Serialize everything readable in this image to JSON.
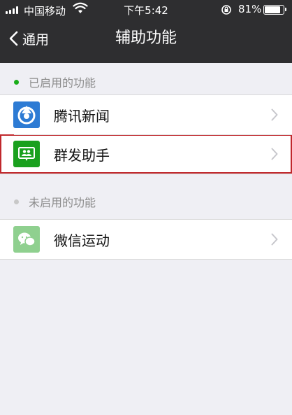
{
  "status_bar": {
    "carrier": "中国移动",
    "time": "下午5:42",
    "battery_percent": "81%"
  },
  "nav": {
    "back_label": "通用",
    "title": "辅助功能"
  },
  "sections": [
    {
      "header": "已启用的功能",
      "dot_color": "#1aad19",
      "items": [
        {
          "label": "腾讯新闻",
          "icon": "tencent-news-icon",
          "icon_color": "#2d7bd4"
        },
        {
          "label": "群发助手",
          "icon": "mass-send-icon",
          "icon_color": "#1aa01e",
          "highlighted": true
        }
      ]
    },
    {
      "header": "未启用的功能",
      "dot_color": "#c8c8c8",
      "items": [
        {
          "label": "微信运动",
          "icon": "wechat-sport-icon",
          "icon_color": "#8fd08f"
        }
      ]
    }
  ],
  "colors": {
    "nav_bg": "#2e2e30",
    "page_bg": "#efeff4",
    "highlight_border": "#c0282c"
  }
}
